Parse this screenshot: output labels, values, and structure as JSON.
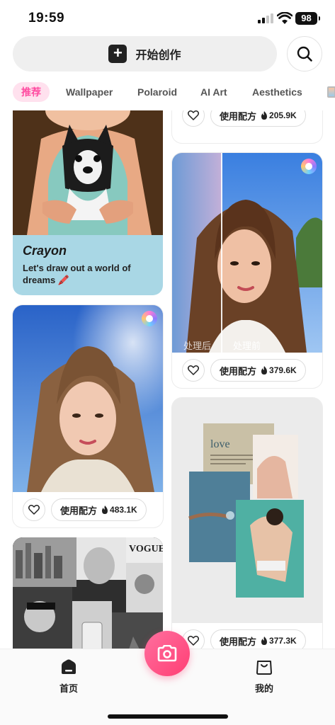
{
  "status_bar": {
    "time": "19:59",
    "battery": "98"
  },
  "header": {
    "create_label": "开始创作"
  },
  "tabs": [
    {
      "label": "推荐",
      "active": true
    },
    {
      "label": "Wallpaper"
    },
    {
      "label": "Polaroid"
    },
    {
      "label": "AI Art"
    },
    {
      "label": "Aesthetics"
    }
  ],
  "cards": {
    "crayon": {
      "title": "Crayon",
      "subtitle": "Let's draw out a world of dreams 🖍️"
    },
    "top_right": {
      "use_label": "使用配方",
      "count": "205.9K"
    },
    "compare": {
      "after_label": "处理后",
      "before_label": "处理前",
      "use_label": "使用配方",
      "count": "379.6K"
    },
    "portrait": {
      "use_label": "使用配方",
      "count": "483.1K"
    },
    "collage": {
      "love_title": "love",
      "use_label": "使用配方",
      "count": "377.3K"
    },
    "bw": {}
  },
  "bottom_nav": {
    "home_label": "首页",
    "mine_label": "我的"
  },
  "colors": {
    "accent": "#ff4aa0",
    "camera": "#ff4f7f",
    "crayon_bg": "#a9d7e5"
  }
}
